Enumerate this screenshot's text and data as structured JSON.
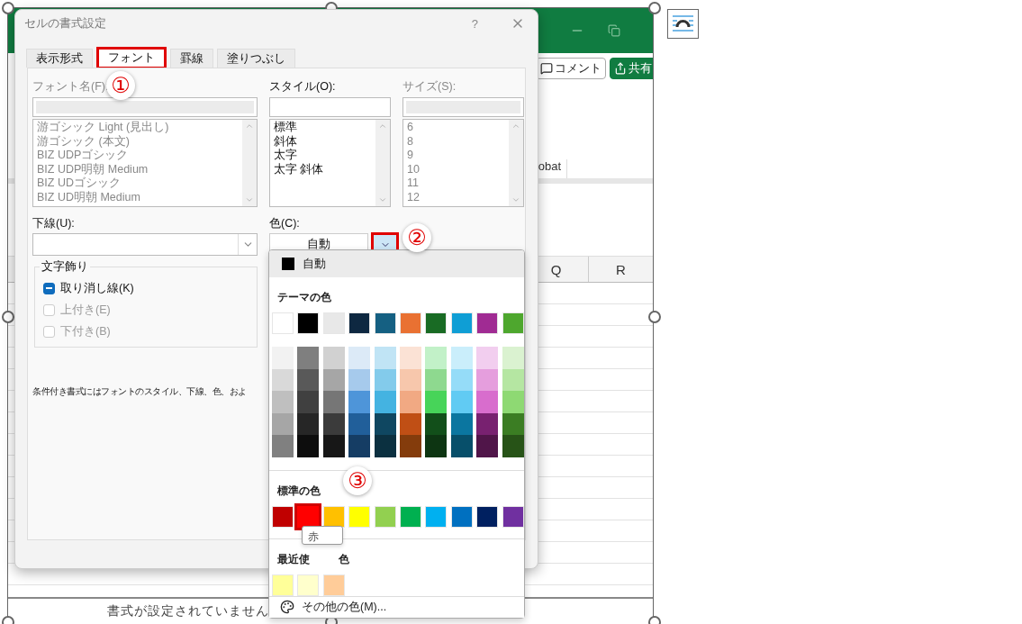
{
  "excel": {
    "buttons": [
      {
        "kind": "comment",
        "label": "コメント"
      },
      {
        "kind": "share",
        "label": "共有"
      }
    ],
    "ribbon_group_label": "obat",
    "columns": [
      "Q",
      "R"
    ],
    "status_text": "書式が設定されていません"
  },
  "dialog": {
    "title": "セルの書式設定",
    "help": "?",
    "tabs": [
      {
        "label": "表示形式",
        "selected": false
      },
      {
        "label": "フォント",
        "selected": true
      },
      {
        "label": "罫線",
        "selected": false
      },
      {
        "label": "塗りつぶし",
        "selected": false
      }
    ],
    "font_name": {
      "label": "フォント名(F):",
      "disabled": true,
      "items": [
        "游ゴシック Light (見出し)",
        "游ゴシック (本文)",
        "BIZ UDPゴシック",
        "BIZ UDP明朝 Medium",
        "BIZ UDゴシック",
        "BIZ UD明朝 Medium"
      ]
    },
    "style": {
      "label": "スタイル(O):",
      "disabled": false,
      "items": [
        "標準",
        "斜体",
        "太字",
        "太字 斜体"
      ]
    },
    "size": {
      "label": "サイズ(S):",
      "disabled": true,
      "items": [
        "6",
        "8",
        "9",
        "10",
        "11",
        "12"
      ]
    },
    "underline": {
      "label": "下線(U):"
    },
    "color": {
      "label": "色(C):",
      "value": "自動"
    },
    "effects": {
      "title": "文字飾り",
      "options": [
        {
          "label": "取り消し線(K)",
          "checked": true,
          "disabled": false
        },
        {
          "label": "上付き(E)",
          "checked": false,
          "disabled": true
        },
        {
          "label": "下付き(B)",
          "checked": false,
          "disabled": true
        }
      ]
    },
    "note": "条件付き書式にはフォントのスタイル、下線、色、およ"
  },
  "palette": {
    "auto_label": "自動",
    "theme_title": "テーマの色",
    "theme": [
      {
        "color": "#ffffff"
      },
      {
        "color": "#000000"
      },
      {
        "color": "#e8e8e8"
      },
      {
        "color": "#0e2841"
      },
      {
        "color": "#156082"
      },
      {
        "color": "#e97132"
      },
      {
        "color": "#196b24"
      },
      {
        "color": "#0f9ed5"
      },
      {
        "color": "#a02b93"
      },
      {
        "color": "#4ea72e"
      }
    ],
    "shades": [
      [
        {
          "color": "#f2f2f2"
        },
        {
          "color": "#7f7f7f"
        },
        {
          "color": "#d1d1d1"
        },
        {
          "color": "#dceaf7"
        },
        {
          "color": "#c0e4f5"
        },
        {
          "color": "#fbe2d5"
        },
        {
          "color": "#c2f1c8"
        },
        {
          "color": "#caeefb"
        },
        {
          "color": "#f2ceef"
        },
        {
          "color": "#daf2d0"
        }
      ],
      [
        {
          "color": "#d9d9d9"
        },
        {
          "color": "#595959"
        },
        {
          "color": "#a6a6a6"
        },
        {
          "color": "#a6caec"
        },
        {
          "color": "#83cbeb"
        },
        {
          "color": "#f7c7ac"
        },
        {
          "color": "#8ed98f"
        },
        {
          "color": "#95dcf8"
        },
        {
          "color": "#e59edd"
        },
        {
          "color": "#b5e6a2"
        }
      ],
      [
        {
          "color": "#bfbfbf"
        },
        {
          "color": "#404040"
        },
        {
          "color": "#767676"
        },
        {
          "color": "#4e95d9"
        },
        {
          "color": "#44b3e1"
        },
        {
          "color": "#f1a983"
        },
        {
          "color": "#47d459"
        },
        {
          "color": "#61cbf3"
        },
        {
          "color": "#d86dcd"
        },
        {
          "color": "#8ed973"
        }
      ],
      [
        {
          "color": "#a6a6a6"
        },
        {
          "color": "#262626"
        },
        {
          "color": "#3b3b3b"
        },
        {
          "color": "#215f9a"
        },
        {
          "color": "#0f4761"
        },
        {
          "color": "#c04f15"
        },
        {
          "color": "#124f1a"
        },
        {
          "color": "#0b76a0"
        },
        {
          "color": "#782170"
        },
        {
          "color": "#3b7d23"
        }
      ],
      [
        {
          "color": "#808080"
        },
        {
          "color": "#0d0d0d"
        },
        {
          "color": "#171717"
        },
        {
          "color": "#153d64"
        },
        {
          "color": "#0b3040"
        },
        {
          "color": "#843c0c"
        },
        {
          "color": "#0d3512"
        },
        {
          "color": "#074f6a"
        },
        {
          "color": "#501549"
        },
        {
          "color": "#275317"
        }
      ]
    ],
    "standard_title": "標準の色",
    "standard": [
      {
        "color": "#c00000",
        "selected": false
      },
      {
        "color": "#ff0000",
        "selected": true
      },
      {
        "color": "#ffc000",
        "selected": false
      },
      {
        "color": "#ffff00",
        "selected": false
      },
      {
        "color": "#92d050",
        "selected": false
      },
      {
        "color": "#00b050",
        "selected": false
      },
      {
        "color": "#00b0f0",
        "selected": false
      },
      {
        "color": "#0070c0",
        "selected": false
      },
      {
        "color": "#002060",
        "selected": false
      },
      {
        "color": "#7030a0",
        "selected": false
      }
    ],
    "tooltip": "赤",
    "recent_title_start": "最近使",
    "recent_title_end": "色",
    "recent": [
      {
        "color": "#ffff99"
      },
      {
        "color": "#ffffcc"
      },
      {
        "color": "#ffcc99"
      }
    ],
    "more": "その他の色(M)..."
  },
  "callouts": [
    "①",
    "②",
    "③"
  ]
}
